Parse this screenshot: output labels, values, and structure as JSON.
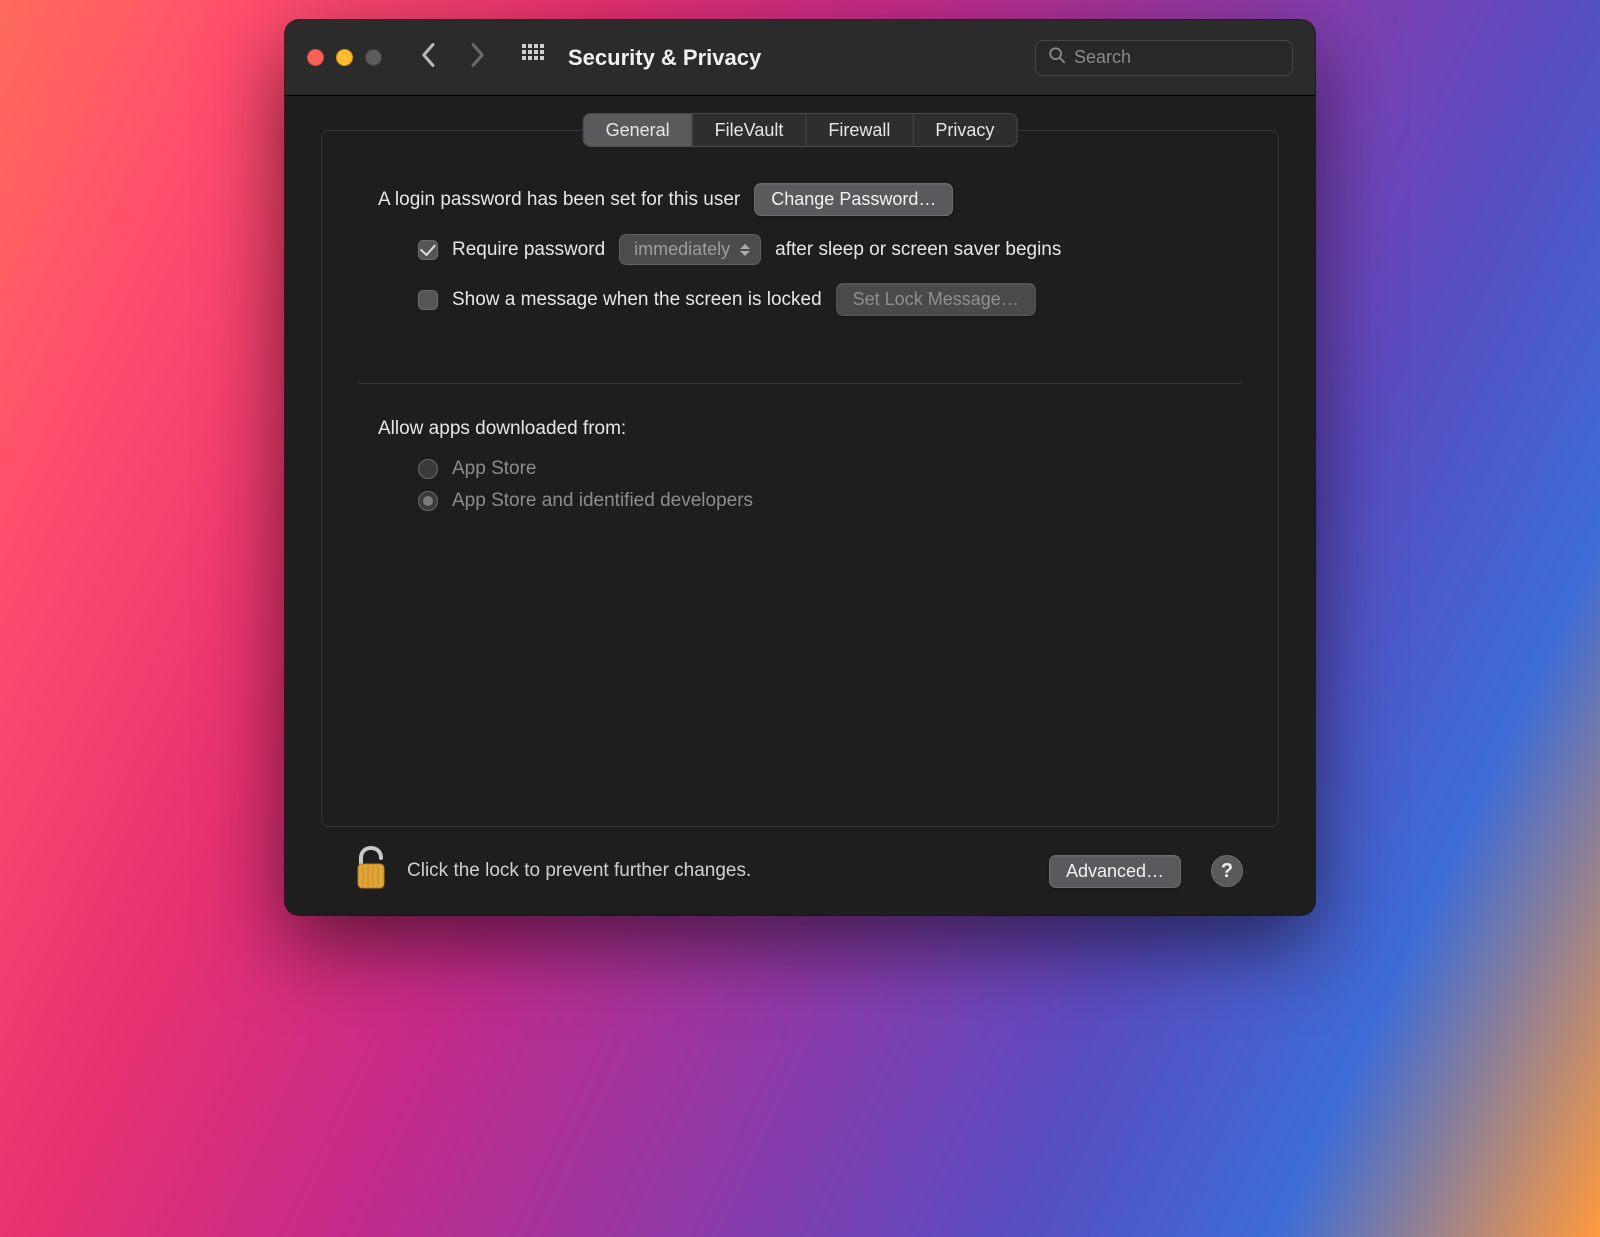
{
  "window": {
    "title": "Security & Privacy"
  },
  "search": {
    "placeholder": "Search"
  },
  "tabs": {
    "general": "General",
    "filevault": "FileVault",
    "firewall": "Firewall",
    "privacy": "Privacy"
  },
  "general": {
    "password_set_text": "A login password has been set for this user",
    "change_password_btn": "Change Password…",
    "require_password_label": "Require password",
    "require_password_select": "immediately",
    "require_password_after": "after sleep or screen saver begins",
    "show_message_label": "Show a message when the screen is locked",
    "set_lock_message_btn": "Set Lock Message…",
    "allow_apps_heading": "Allow apps downloaded from:",
    "radio_app_store": "App Store",
    "radio_identified": "App Store and identified developers"
  },
  "footer": {
    "lock_text": "Click the lock to prevent further changes.",
    "advanced_btn": "Advanced…",
    "help_label": "?"
  }
}
